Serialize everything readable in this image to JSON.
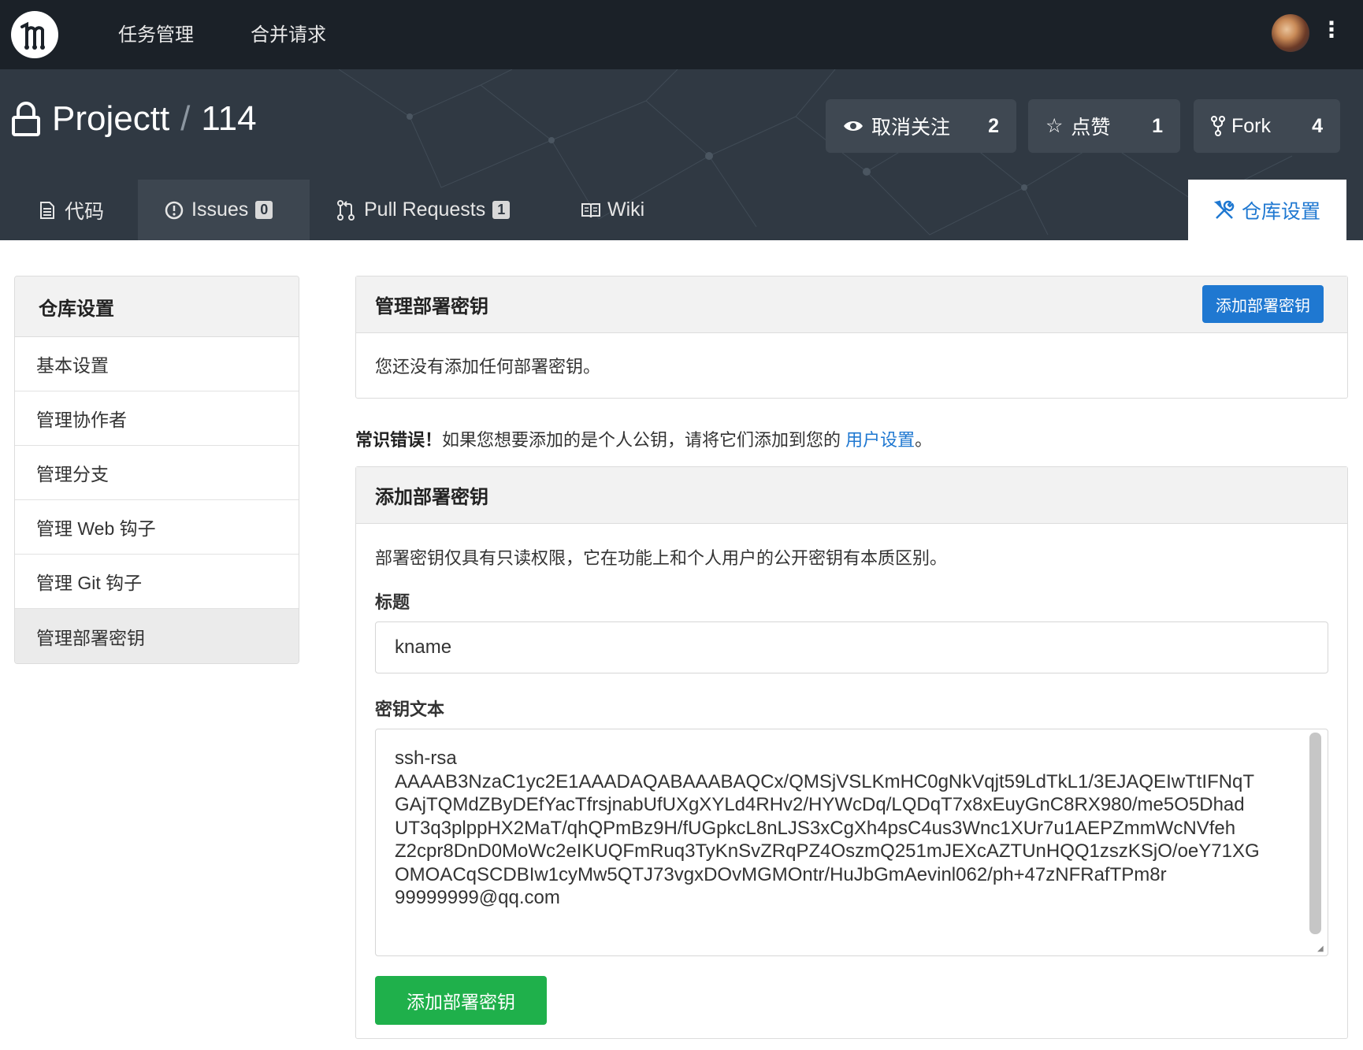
{
  "topbar": {
    "nav": [
      "任务管理",
      "合并请求"
    ]
  },
  "repo": {
    "owner": "Projectt",
    "name": "114",
    "watch_label": "取消关注",
    "watch_count": "2",
    "star_label": "点赞",
    "star_count": "1",
    "fork_label": "Fork",
    "fork_count": "4"
  },
  "tabs": {
    "code": "代码",
    "issues": "Issues",
    "issues_count": "0",
    "pulls": "Pull Requests",
    "pulls_count": "1",
    "wiki": "Wiki",
    "settings": "仓库设置"
  },
  "sidebar": {
    "title": "仓库设置",
    "items": [
      "基本设置",
      "管理协作者",
      "管理分支",
      "管理 Web 钩子",
      "管理 Git 钩子",
      "管理部署密钥"
    ]
  },
  "manage_keys": {
    "title": "管理部署密钥",
    "add_button": "添加部署密钥",
    "empty_text": "您还没有添加任何部署密钥。"
  },
  "warning": {
    "strong": "常识错误！",
    "text": "如果您想要添加的是个人公钥，请将它们添加到您的 ",
    "link": "用户设置",
    "end": "。"
  },
  "add_key": {
    "title": "添加部署密钥",
    "description": "部署密钥仅具有只读权限，它在功能上和个人用户的公开密钥有本质区别。",
    "title_label": "标题",
    "title_value": "kname",
    "content_label": "密钥文本",
    "content_lines": [
      "ssh-rsa",
      "AAAAB3NzaC1yc2E1AAADAQABAAABAQCx/QMSjVSLKmHC0gNkVqjt59LdTkL1/3EJAQEIwTtIFNqT",
      "GAjTQMdZByDEfYacTfrsjnabUfUXgXYLd4RHv2/HYWcDq/LQDqT7x8xEuyGnC8RX980/me5O5Dhad",
      "UT3q3plppHX2MaT/qhQPmBz9H/fUGpkcL8nLJS3xCgXh4psC4us3Wnc1XUr7u1AEPZmmWcNVfeh",
      "Z2cpr8DnD0MoWc2eIKUQFmRuq3TyKnSvZRqPZ4OszmQ251mJEXcAZTUnHQQ1zszKSjO/oeY71XG",
      "OMOACqSCDBIw1cyMw5QTJ73vgxDOvMGMOntr/HuJbGmAevinl062/ph+47zNFRafTPm8r",
      "99999999@qq.com"
    ],
    "submit": "添加部署密钥"
  },
  "colors": {
    "topbar": "#1b2128",
    "header": "#303943",
    "primary": "#1f78d1",
    "success": "#1fb04b"
  }
}
